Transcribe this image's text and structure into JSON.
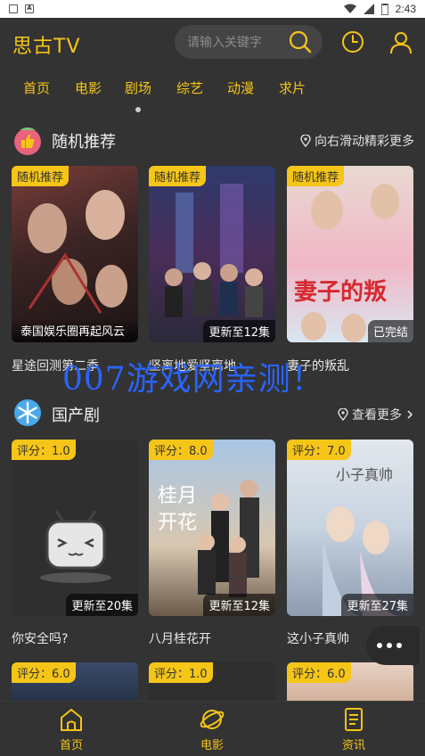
{
  "status": {
    "time": "2:43"
  },
  "app": {
    "title": "思古TV"
  },
  "search": {
    "placeholder": "请输入关键字"
  },
  "tabs": [
    "首页",
    "电影",
    "剧场",
    "综艺",
    "动漫",
    "求片"
  ],
  "sections": {
    "random": {
      "title": "随机推荐",
      "more": "向右滑动精彩更多",
      "cards": [
        {
          "tag": "随机推荐",
          "caption": "泰国娱乐圈再起风云",
          "badge": "",
          "title": "星途回测第二季"
        },
        {
          "tag": "随机推荐",
          "caption": "",
          "badge": "更新至12集",
          "title": "坚离地爱坚离地"
        },
        {
          "tag": "随机推荐",
          "caption": "",
          "badge": "已完结",
          "title": "妻子的叛乱"
        }
      ]
    },
    "domestic": {
      "title": "国产剧",
      "more": "查看更多",
      "cards": [
        {
          "tag": "评分：1.0",
          "badge": "更新至20集",
          "title": "你安全吗?"
        },
        {
          "tag": "评分：8.0",
          "badge": "更新至12集",
          "title": "八月桂花开"
        },
        {
          "tag": "评分：7.0",
          "badge": "更新至27集",
          "title": "这小子真帅"
        }
      ],
      "next_row": [
        {
          "tag": "评分：6.0"
        },
        {
          "tag": "评分：1.0"
        },
        {
          "tag": "评分：6.0"
        }
      ]
    }
  },
  "watermark": "007游戏网亲测！",
  "bottom_nav": [
    "首页",
    "电影",
    "资讯"
  ],
  "colors": {
    "accent": "#f5c518",
    "background": "#333333"
  }
}
